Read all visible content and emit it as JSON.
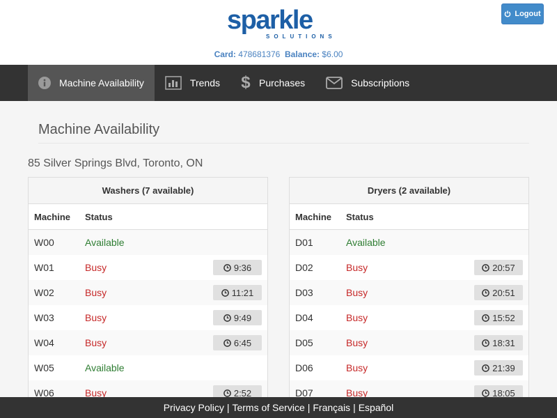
{
  "brand": {
    "word": "sparkle",
    "sub": "SOLUTIONS"
  },
  "logout_label": "Logout",
  "account": {
    "card_label": "Card:",
    "card_number": "478681376",
    "balance_label": "Balance:",
    "balance": "$6.00"
  },
  "nav": [
    {
      "label": "Machine Availability",
      "icon": "info-icon",
      "active": true
    },
    {
      "label": "Trends",
      "icon": "bar-chart-icon",
      "active": false
    },
    {
      "label": "Purchases",
      "icon": "dollar-icon",
      "active": false
    },
    {
      "label": "Subscriptions",
      "icon": "envelope-icon",
      "active": false
    }
  ],
  "page_title": "Machine Availability",
  "address": "85 Silver Springs Blvd, Toronto, ON",
  "washers": {
    "heading": "Washers (7 available)",
    "col_machine": "Machine",
    "col_status": "Status",
    "rows": [
      {
        "machine": "W00",
        "status": "Available",
        "time": ""
      },
      {
        "machine": "W01",
        "status": "Busy",
        "time": "9:36"
      },
      {
        "machine": "W02",
        "status": "Busy",
        "time": "11:21"
      },
      {
        "machine": "W03",
        "status": "Busy",
        "time": "9:49"
      },
      {
        "machine": "W04",
        "status": "Busy",
        "time": "6:45"
      },
      {
        "machine": "W05",
        "status": "Available",
        "time": ""
      },
      {
        "machine": "W06",
        "status": "Busy",
        "time": "2:52"
      }
    ]
  },
  "dryers": {
    "heading": "Dryers (2 available)",
    "col_machine": "Machine",
    "col_status": "Status",
    "rows": [
      {
        "machine": "D01",
        "status": "Available",
        "time": ""
      },
      {
        "machine": "D02",
        "status": "Busy",
        "time": "20:57"
      },
      {
        "machine": "D03",
        "status": "Busy",
        "time": "20:51"
      },
      {
        "machine": "D04",
        "status": "Busy",
        "time": "15:52"
      },
      {
        "machine": "D05",
        "status": "Busy",
        "time": "18:31"
      },
      {
        "machine": "D06",
        "status": "Busy",
        "time": "21:39"
      },
      {
        "machine": "D07",
        "status": "Busy",
        "time": "18:05"
      }
    ]
  },
  "footer": {
    "privacy": "Privacy Policy",
    "terms": "Terms of Service",
    "francais": "Français",
    "espanol": "Español"
  },
  "colors": {
    "brand": "#1d5fa6",
    "navbar": "#333333",
    "available": "#2e7d32",
    "busy": "#c62828",
    "logout": "#428bca"
  }
}
